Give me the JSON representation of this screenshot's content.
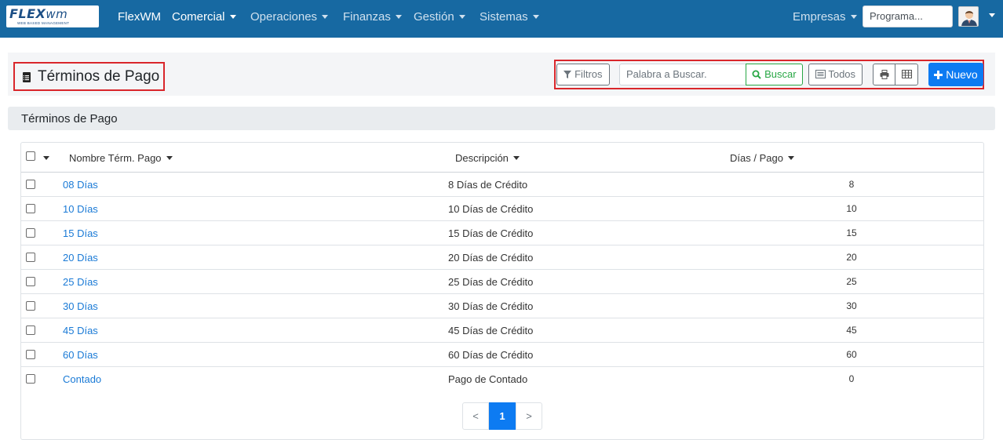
{
  "navbar": {
    "logo_text_flex": "FLEX",
    "logo_text_wm": "wm",
    "logo_subtitle": "WEB BASED MANAGEMENT",
    "brand": "FlexWM",
    "menus": [
      "Comercial",
      "Operaciones",
      "Finanzas",
      "Gestión",
      "Sistemas"
    ],
    "active_menu": "Comercial",
    "companies_label": "Empresas",
    "search_placeholder": "Programa..."
  },
  "header": {
    "title": "Términos de Pago",
    "icon": "document-icon"
  },
  "toolbar": {
    "filters_label": "Filtros",
    "search_placeholder": "Palabra a Buscar.",
    "search_button": "Buscar",
    "all_button": "Todos",
    "print_icon": "print-icon",
    "grid_icon": "table-grid-icon",
    "new_button": "Nuevo"
  },
  "section": {
    "title": "Términos de Pago"
  },
  "table": {
    "columns": [
      "Nombre Térm. Pago",
      "Descripción",
      "Días / Pago"
    ],
    "rows": [
      {
        "name": "08 Días",
        "description": "8 Días de Crédito",
        "days": "8"
      },
      {
        "name": "10 Días",
        "description": "10 Días de Crédito",
        "days": "10"
      },
      {
        "name": "15 Días",
        "description": "15 Días de Crédito",
        "days": "15"
      },
      {
        "name": "20 Días",
        "description": "20 Días de Crédito",
        "days": "20"
      },
      {
        "name": "25 Días",
        "description": "25 Días de Crédito",
        "days": "25"
      },
      {
        "name": "30 Días",
        "description": "30 Días de Crédito",
        "days": "30"
      },
      {
        "name": "45 Días",
        "description": "45 Días de Crédito",
        "days": "45"
      },
      {
        "name": "60 Días",
        "description": "60 Días de Crédito",
        "days": "60"
      },
      {
        "name": "Contado",
        "description": "Pago de Contado",
        "days": "0"
      }
    ]
  },
  "pagination": {
    "prev": "<",
    "current": "1",
    "next": ">"
  },
  "colors": {
    "navbar": "#1769a2",
    "primary": "#0d7bf2",
    "success": "#28a745",
    "highlight_border": "#d9262b",
    "link": "#1a7ad6"
  }
}
